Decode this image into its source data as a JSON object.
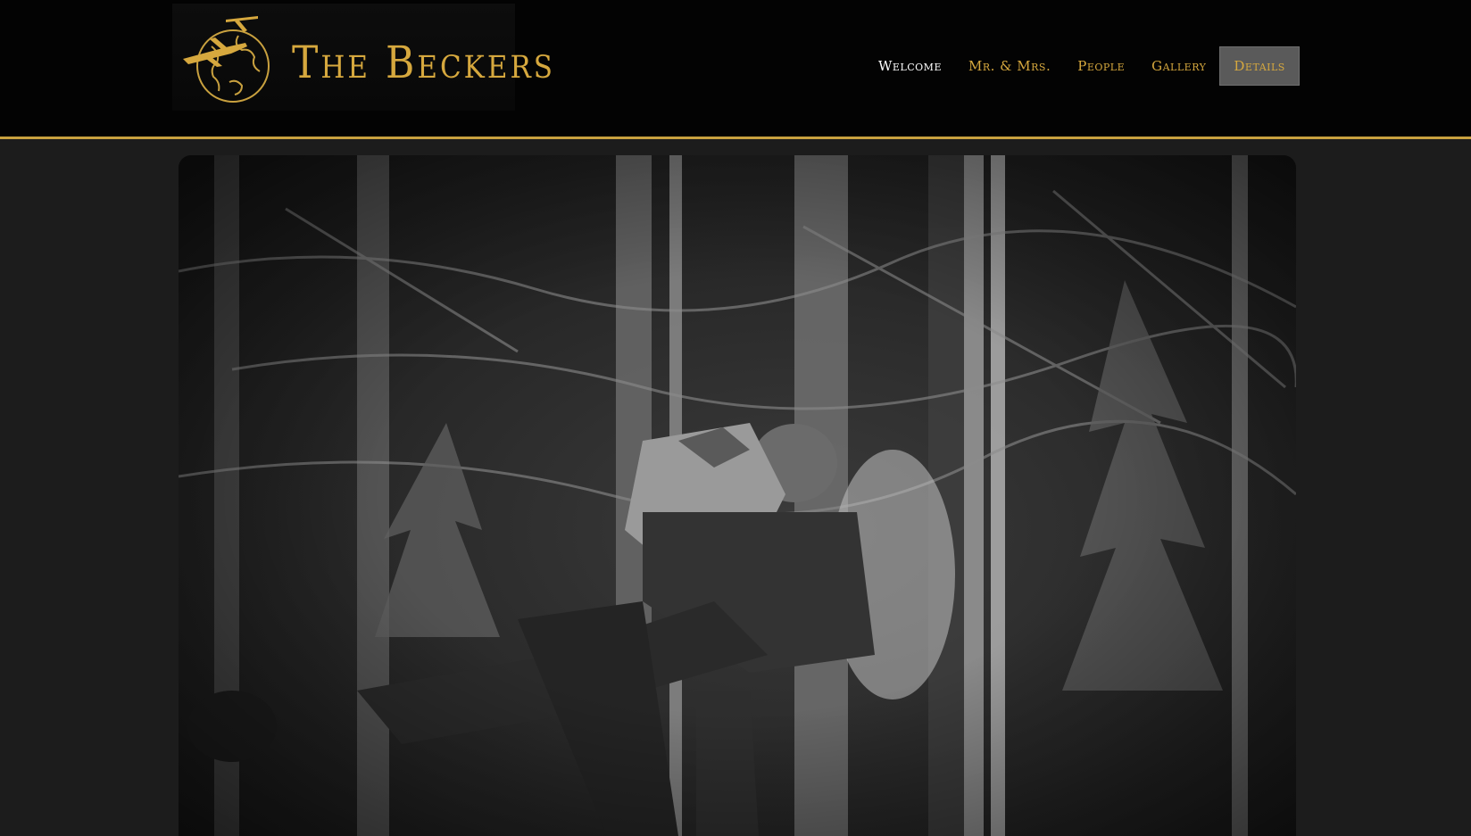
{
  "site": {
    "logo_text": "The Beckers",
    "logo_mark_icon": "globe-airplane-icon",
    "brand_color": "#d6a83e"
  },
  "nav": {
    "items": [
      {
        "label": "Welcome"
      },
      {
        "label": "Mr. & Mrs."
      },
      {
        "label": "People"
      },
      {
        "label": "Gallery"
      },
      {
        "label": "Details"
      }
    ]
  },
  "hero": {
    "image_icon": "couple-kissing-in-forest-photo"
  }
}
